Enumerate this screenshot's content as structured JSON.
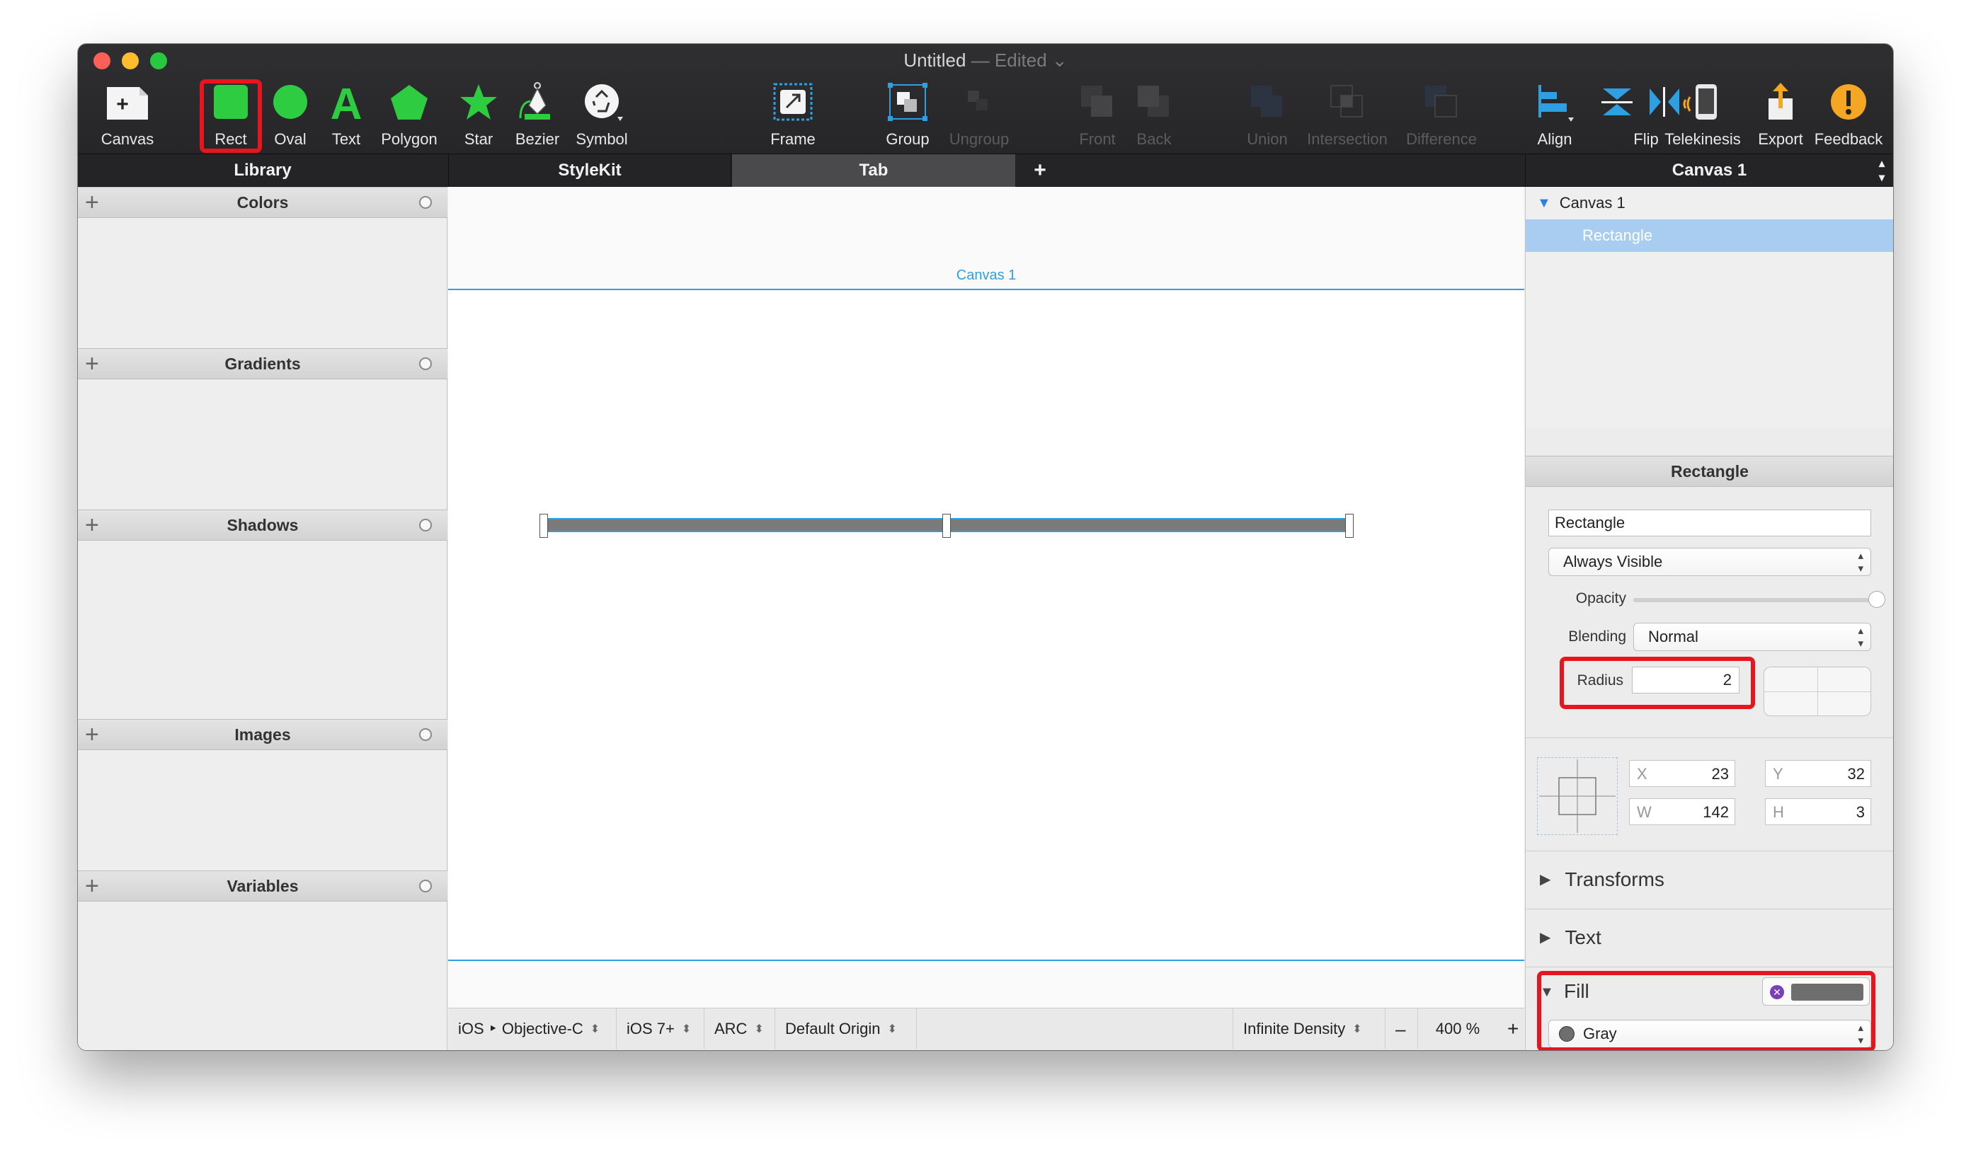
{
  "window": {
    "title": "Untitled",
    "subtitle": "— Edited ⌄"
  },
  "toolbar": {
    "items": [
      {
        "label": "Canvas",
        "icon": "canvas-add-icon"
      },
      {
        "label": "Rect",
        "icon": "rect-icon"
      },
      {
        "label": "Oval",
        "icon": "oval-icon"
      },
      {
        "label": "Text",
        "icon": "text-icon"
      },
      {
        "label": "Polygon",
        "icon": "polygon-icon"
      },
      {
        "label": "Star",
        "icon": "star-icon"
      },
      {
        "label": "Bezier",
        "icon": "bezier-pen-icon"
      },
      {
        "label": "Symbol",
        "icon": "symbol-icon"
      },
      {
        "label": "Frame",
        "icon": "frame-icon"
      },
      {
        "label": "Group",
        "icon": "group-icon"
      },
      {
        "label": "Ungroup",
        "icon": "ungroup-icon"
      },
      {
        "label": "Front",
        "icon": "bring-front-icon"
      },
      {
        "label": "Back",
        "icon": "send-back-icon"
      },
      {
        "label": "Union",
        "icon": "union-icon"
      },
      {
        "label": "Intersection",
        "icon": "intersection-icon"
      },
      {
        "label": "Difference",
        "icon": "difference-icon"
      },
      {
        "label": "Align",
        "icon": "align-icon"
      },
      {
        "label": "Flip",
        "icon": "flip-icon"
      },
      {
        "label": "Telekinesis",
        "icon": "telekinesis-phone-icon"
      },
      {
        "label": "Export",
        "icon": "export-icon"
      },
      {
        "label": "Feedback",
        "icon": "feedback-icon"
      }
    ]
  },
  "tabs": {
    "library": "Library",
    "stylekit": "StyleKit",
    "tab": "Tab",
    "add": "+",
    "canvas_selector": "Canvas 1"
  },
  "library": {
    "sections": [
      {
        "label": "Colors"
      },
      {
        "label": "Gradients"
      },
      {
        "label": "Shadows"
      },
      {
        "label": "Images"
      },
      {
        "label": "Variables"
      }
    ]
  },
  "canvas": {
    "name": "Canvas 1",
    "shape_color": "#7a7a7a"
  },
  "statusbar": {
    "language": "iOS ‣ Objective-C",
    "ios_version": "iOS 7+",
    "memory": "ARC",
    "origin": "Default Origin",
    "density": "Infinite Density",
    "zoom_out": "–",
    "zoom": "400 %",
    "zoom_in": "+"
  },
  "tree": {
    "root": "Canvas 1",
    "child": "Rectangle"
  },
  "inspector": {
    "header": "Rectangle",
    "name_value": "Rectangle",
    "visibility": "Always Visible",
    "opacity_label": "Opacity",
    "opacity": 1.0,
    "blending_label": "Blending",
    "blending": "Normal",
    "radius_label": "Radius",
    "radius": "2",
    "x_label": "X",
    "x": "23",
    "y_label": "Y",
    "y": "32",
    "w_label": "W",
    "w": "142",
    "h_label": "H",
    "h": "3",
    "transforms": "Transforms",
    "text": "Text",
    "fill": "Fill",
    "fill_color_name": "Gray",
    "fill_color": "#6e6e6e"
  },
  "colors": {
    "highlight": "#e8141e",
    "accent": "#2e9fe0",
    "selection": "#a9cdf0",
    "tool_green": "#2ecc40"
  }
}
